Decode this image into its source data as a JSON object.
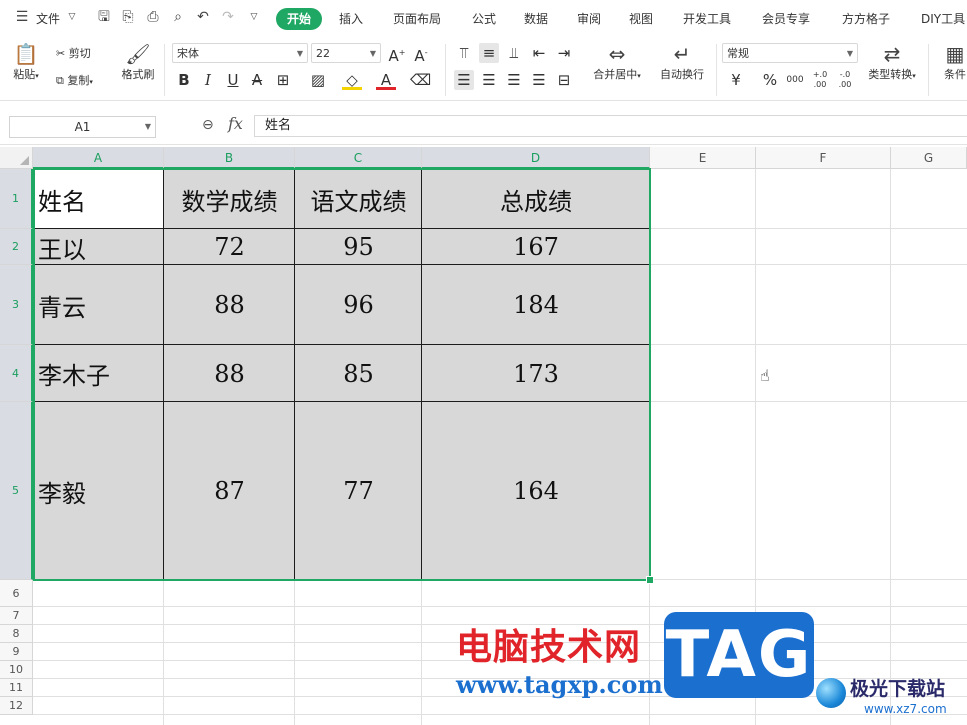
{
  "menubar": {
    "file": "文件",
    "tabs": [
      "开始",
      "插入",
      "页面布局",
      "公式",
      "数据",
      "审阅",
      "视图",
      "开发工具",
      "会员专享",
      "方方格子",
      "DIY工具"
    ]
  },
  "ribbon": {
    "paste": "粘贴",
    "cut": "剪切",
    "copy": "复制",
    "format_painter": "格式刷",
    "font_name": "宋体",
    "font_size": "22",
    "bold": "B",
    "italic": "I",
    "underline": "U",
    "merge_center": "合并居中",
    "wrap_text": "自动换行",
    "number_format": "常规",
    "currency": "¥",
    "percent": "%",
    "thousands": "000",
    "inc_decimal": "+.0 .00",
    "dec_decimal": "-.0 .00",
    "type_convert": "类型转换",
    "conditional": "条件"
  },
  "formula_bar": {
    "cell_ref": "A1",
    "fx": "fx",
    "content": "姓名"
  },
  "grid": {
    "columns": [
      "A",
      "B",
      "C",
      "D",
      "E",
      "F",
      "G"
    ],
    "rows": [
      "1",
      "2",
      "3",
      "4",
      "5",
      "6",
      "7",
      "8",
      "9",
      "10",
      "11",
      "12"
    ],
    "table": [
      [
        "姓名",
        "数学成绩",
        "语文成绩",
        "总成绩"
      ],
      [
        "王以",
        "72",
        "95",
        "167"
      ],
      [
        "青云",
        "88",
        "96",
        "184"
      ],
      [
        "李木子",
        "88",
        "85",
        "173"
      ],
      [
        "李毅",
        "87",
        "77",
        "164"
      ]
    ]
  },
  "watermark": {
    "site_name": "电脑技术网",
    "url": "www.tagxp.com",
    "tag": "TAG",
    "logo_name": "极光下载站",
    "logo_url": "www.xz7.com"
  },
  "colors": {
    "accent": "#1fa764",
    "cell_fill": "#d8d8d8",
    "watermark_red": "#e0242a",
    "watermark_blue": "#1b6fcf"
  }
}
